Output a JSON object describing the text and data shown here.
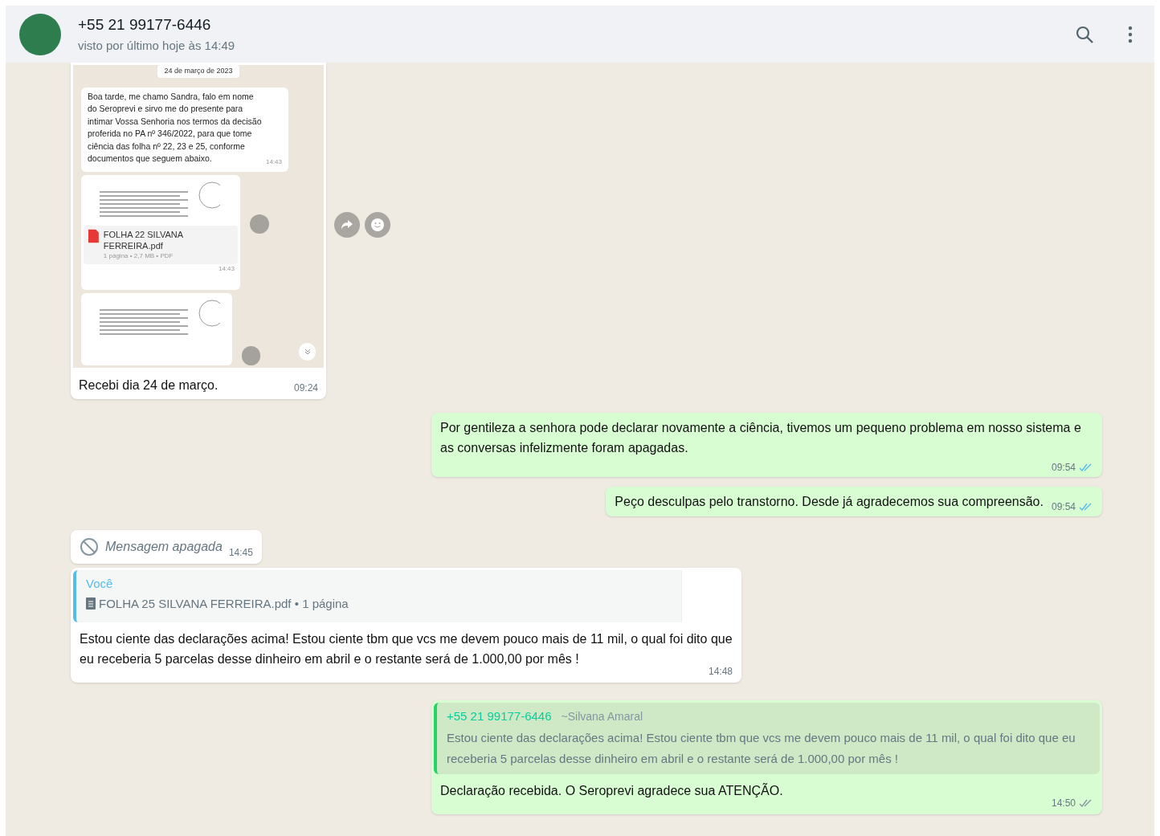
{
  "header": {
    "contact_name": "+55 21 99177-6446",
    "status": "visto por último hoje às 14:49"
  },
  "messages": [
    {
      "kind": "image",
      "outgoing": false,
      "caption": "Recebi dia 24 de março.",
      "time": "09:24",
      "screenshot": {
        "date": "24 de março de 2023",
        "text": "Boa tarde, me chamo Sandra, falo em nome do Seroprevi e sirvo me do presente para intimar Vossa Senhoria nos termos da decisão proferida no PA nº 346/2022, para que tome ciência das folha nº 22, 23 e 25, conforme documentos que seguem abaixo.",
        "text_time": "14:43",
        "document": {
          "name": "FOLHA 22 SILVANA FERREIRA.pdf",
          "meta": "1 página • 2,7 MB • PDF",
          "time": "14:43"
        }
      }
    },
    {
      "kind": "text",
      "outgoing": true,
      "text": "Por gentileza a senhora pode declarar novamente a ciência, tivemos um pequeno problema em nosso sistema e as conversas infelizmente foram apagadas.",
      "time": "09:54",
      "read": true
    },
    {
      "kind": "text",
      "outgoing": true,
      "text": "Peço desculpas pelo transtorno. Desde já agradecemos sua compreensão.",
      "time": "09:54",
      "read": true
    },
    {
      "kind": "deleted",
      "outgoing": false,
      "text": "Mensagem apagada",
      "time": "14:45"
    },
    {
      "kind": "quoted",
      "outgoing": false,
      "quote_author": "Você",
      "quote_text": "FOLHA 25 SILVANA FERREIRA.pdf • 1 página",
      "text": "Estou ciente das declarações acima! Estou ciente tbm que vcs me devem pouco mais de 11 mil, o qual foi dito que eu receberia 5 parcelas desse dinheiro em abril e o restante será de 1.000,00 por mês !",
      "time": "14:48"
    },
    {
      "kind": "quoted",
      "outgoing": true,
      "quote_author": "+55 21 99177-6446",
      "quote_name": "~Silvana Amaral",
      "quote_text": "Estou ciente das declarações acima! Estou ciente tbm que vcs me devem pouco mais de 11 mil, o qual foi dito que eu receberia 5 parcelas desse dinheiro em abril e o restante será de 1.000,00 por mês !",
      "text": "Declaração recebida. O Seroprevi agradece sua ATENÇÃO.",
      "time": "14:50",
      "read": false
    }
  ]
}
